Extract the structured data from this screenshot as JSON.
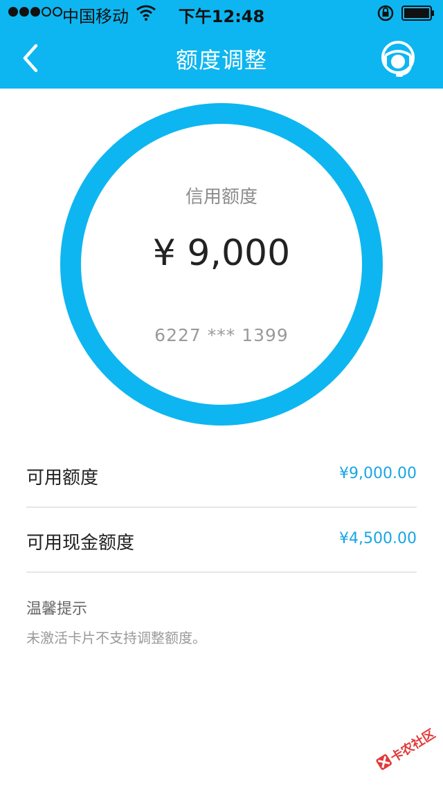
{
  "status_bar": {
    "carrier": "中国移动",
    "time": "下午12:48"
  },
  "nav": {
    "title": "额度调整",
    "back_icon": "chevron-left-icon",
    "support_icon": "customer-service-icon"
  },
  "credit": {
    "label": "信用额度",
    "amount": "¥ 9,000",
    "card_number": "6227 *** 1399"
  },
  "rows": [
    {
      "label": "可用额度",
      "value": "¥9,000.00"
    },
    {
      "label": "可用现金额度",
      "value": "¥4,500.00"
    }
  ],
  "tip": {
    "title": "温馨提示",
    "text": "未激活卡片不支持调整额度。"
  },
  "watermark": {
    "text": "卡农社区"
  },
  "colors": {
    "accent": "#0db6f0",
    "value_blue": "#17a6e3"
  }
}
